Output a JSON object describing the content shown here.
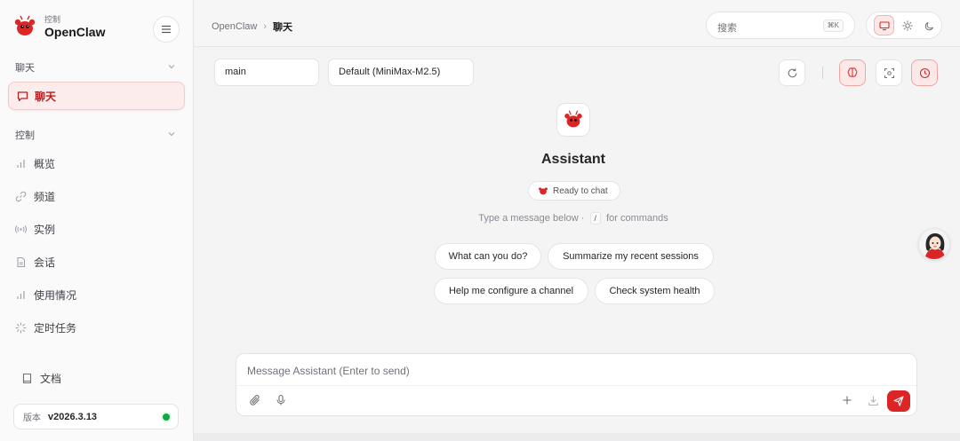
{
  "brand": {
    "subtitle": "控制",
    "name": "OpenClaw"
  },
  "sidebar": {
    "sections": [
      {
        "label": "聊天"
      },
      {
        "label": "控制"
      }
    ],
    "active_item": {
      "label": "聊天",
      "icon": "chat-bubble-icon"
    },
    "items": [
      {
        "label": "概览",
        "icon": "bar-chart-icon"
      },
      {
        "label": "频道",
        "icon": "link-icon"
      },
      {
        "label": "实例",
        "icon": "radio-signal-icon"
      },
      {
        "label": "会话",
        "icon": "document-icon"
      },
      {
        "label": "使用情况",
        "icon": "bar-chart-icon"
      },
      {
        "label": "定时任务",
        "icon": "loader-icon"
      }
    ],
    "docs": {
      "label": "文档",
      "icon": "book-icon"
    },
    "version": {
      "label": "版本",
      "value": "v2026.3.13",
      "status_color": "#16a34a"
    }
  },
  "topbar": {
    "breadcrumb": [
      "OpenClaw",
      "聊天"
    ],
    "search": {
      "placeholder": "搜索",
      "shortcut": "⌘K"
    },
    "theme": {
      "active": "monitor-icon",
      "options": [
        "monitor-icon",
        "sun-icon",
        "moon-icon"
      ]
    }
  },
  "toolbar": {
    "session_value": "main",
    "model_value": "Default (MiniMax-M2.5)",
    "buttons": [
      "refresh-icon",
      "brain-icon",
      "focus-icon",
      "clock-icon"
    ]
  },
  "assistant": {
    "name": "Assistant",
    "status": "Ready to chat",
    "hint_before": "Type a message below ·",
    "hint_key": "/",
    "hint_after": "for commands"
  },
  "suggestions": [
    "What can you do?",
    "Summarize my recent sessions",
    "Help me configure a channel",
    "Check system health"
  ],
  "composer": {
    "placeholder": "Message Assistant (Enter to send)"
  },
  "colors": {
    "accent": "#dc2626",
    "accent_soft": "#fde8e8"
  }
}
